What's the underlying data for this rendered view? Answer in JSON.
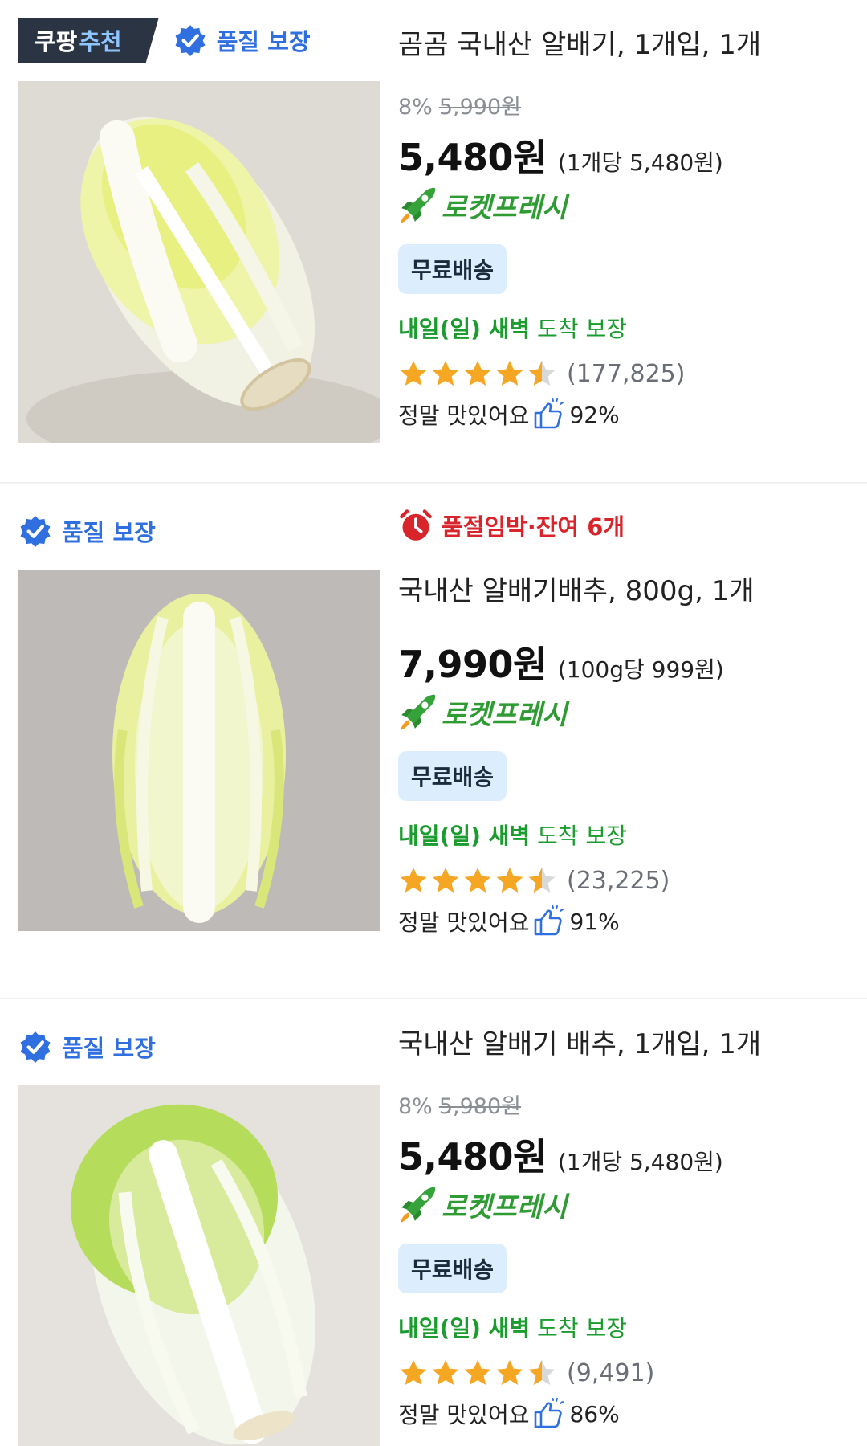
{
  "products": [
    {
      "top_badge": {
        "main": "쿠팡",
        "accent": "추천"
      },
      "quality_label": "품질 보장",
      "title": "곰곰 국내산 알배기, 1개입, 1개",
      "discount": "8%",
      "original_price": "5,990원",
      "price": "5,480원",
      "unit_price": "(1개당 5,480원)",
      "rocket_label": "로켓프레시",
      "shipping_label": "무료배송",
      "delivery": {
        "strong": "내일(일) 새벽",
        "light": " 도착 보장"
      },
      "rating_stars": 4.5,
      "review_count": "(177,825)",
      "review_text": "정말 맛있어요",
      "review_percent": "92%",
      "cabbage_tone": "pale"
    },
    {
      "quality_label": "품질 보장",
      "urgency": "품절임박·잔여 6개",
      "title": "국내산 알배기배추, 800g, 1개",
      "price": "7,990원",
      "unit_price": "(100g당 999원)",
      "rocket_label": "로켓프레시",
      "shipping_label": "무료배송",
      "delivery": {
        "strong": "내일(일) 새벽",
        "light": " 도착 보장"
      },
      "rating_stars": 4.5,
      "review_count": "(23,225)",
      "review_text": "정말 맛있어요",
      "review_percent": "91%",
      "cabbage_tone": "yellow-green"
    },
    {
      "quality_label": "품질 보장",
      "title": "국내산 알배기 배추, 1개입, 1개",
      "discount": "8%",
      "original_price": "5,980원",
      "price": "5,480원",
      "unit_price": "(1개당 5,480원)",
      "rocket_label": "로켓프레시",
      "shipping_label": "무료배송",
      "delivery": {
        "strong": "내일(일) 새벽",
        "light": " 도착 보장"
      },
      "rating_stars": 4.5,
      "review_count": "(9,491)",
      "review_text": "정말 맛있어요",
      "review_percent": "86%",
      "cabbage_tone": "green"
    }
  ],
  "colors": {
    "quality": "#2f6fe0",
    "rocket": "#2e9b33",
    "urgent": "#d8252c",
    "star": "#f5a623"
  }
}
